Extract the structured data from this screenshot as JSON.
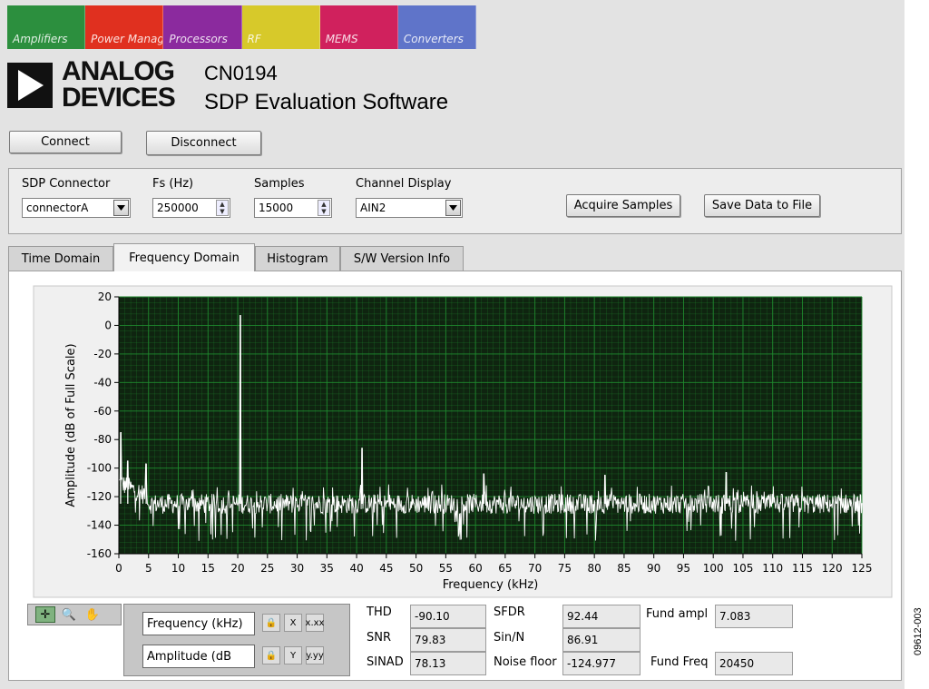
{
  "window": {
    "colors": {
      "background": "#e3e3e3",
      "plot_bg": "#0f2410",
      "grid": "#1f8a2e",
      "trace": "#ffffff"
    }
  },
  "banner": {
    "tiles": [
      {
        "color": "#2c8f3e",
        "text": "Amplifiers"
      },
      {
        "color": "#e0301f",
        "text": "Power Management"
      },
      {
        "color": "#8b2a9e",
        "text": "Processors"
      },
      {
        "color": "#d7c92a",
        "text": "RF"
      },
      {
        "color": "#d0215d",
        "text": "MEMS"
      },
      {
        "color": "#5f74c9",
        "text": "Converters"
      }
    ]
  },
  "header": {
    "logo_line1": "ANALOG",
    "logo_line2": "DEVICES",
    "title": "CN0194",
    "subtitle": "SDP Evaluation Software"
  },
  "toolbar": {
    "connect_label": "Connect",
    "disconnect_label": "Disconnect"
  },
  "controls": {
    "sdp_connector": {
      "label": "SDP Connector",
      "value": "connectorA"
    },
    "fs": {
      "label": "Fs (Hz)",
      "value": "250000"
    },
    "samples": {
      "label": "Samples",
      "value": "15000"
    },
    "channel": {
      "label": "Channel Display",
      "value": "AIN2"
    },
    "acquire_label": "Acquire Samples",
    "save_label": "Save Data to File"
  },
  "tabs": [
    {
      "label": "Time Domain",
      "active": false
    },
    {
      "label": "Frequency Domain",
      "active": true
    },
    {
      "label": "Histogram",
      "active": false
    },
    {
      "label": "S/W Version Info",
      "active": false
    }
  ],
  "chart_data": {
    "type": "line",
    "xlabel": "Frequency (kHz)",
    "ylabel": "Amplitude (dB of Full Scale)",
    "xlim": [
      0,
      125
    ],
    "ylim": [
      -160,
      20
    ],
    "xticks": [
      0,
      5,
      10,
      15,
      20,
      25,
      30,
      35,
      40,
      45,
      50,
      55,
      60,
      65,
      70,
      75,
      80,
      85,
      90,
      95,
      100,
      105,
      110,
      115,
      120,
      125
    ],
    "yticks": [
      20,
      0,
      -20,
      -40,
      -60,
      -80,
      -100,
      -120,
      -140,
      -160
    ],
    "grid": true,
    "noise_floor_db": -125,
    "spurs": [
      {
        "x": 0.3,
        "y": -75
      },
      {
        "x": 1.5,
        "y": -95
      },
      {
        "x": 4.6,
        "y": -97
      },
      {
        "x": 20.45,
        "y": 7
      },
      {
        "x": 40.9,
        "y": -86
      },
      {
        "x": 61.4,
        "y": -104
      },
      {
        "x": 81.8,
        "y": -105
      },
      {
        "x": 102.2,
        "y": -103
      }
    ]
  },
  "scale": {
    "x_name": "Frequency (kHz)",
    "y_name": "Amplitude (dB",
    "x_icon": "X",
    "y_icon": "Y",
    "x_fmt": "x.xx",
    "y_fmt": "y.yy"
  },
  "stats": {
    "thd": {
      "label": "THD",
      "value": "-90.10"
    },
    "snr": {
      "label": "SNR",
      "value": "79.83"
    },
    "sinad": {
      "label": "SINAD",
      "value": "78.13"
    },
    "sfdr": {
      "label": "SFDR",
      "value": "92.44"
    },
    "sin_n": {
      "label": "Sin/N",
      "value": "86.91"
    },
    "noise_floor": {
      "label": "Noise floor",
      "value": "-124.977"
    },
    "fund_ampl": {
      "label": "Fund ampl",
      "value": "7.083"
    },
    "fund_freq": {
      "label": "Fund Freq",
      "value": "20450"
    }
  },
  "figure_code": "09612-003"
}
